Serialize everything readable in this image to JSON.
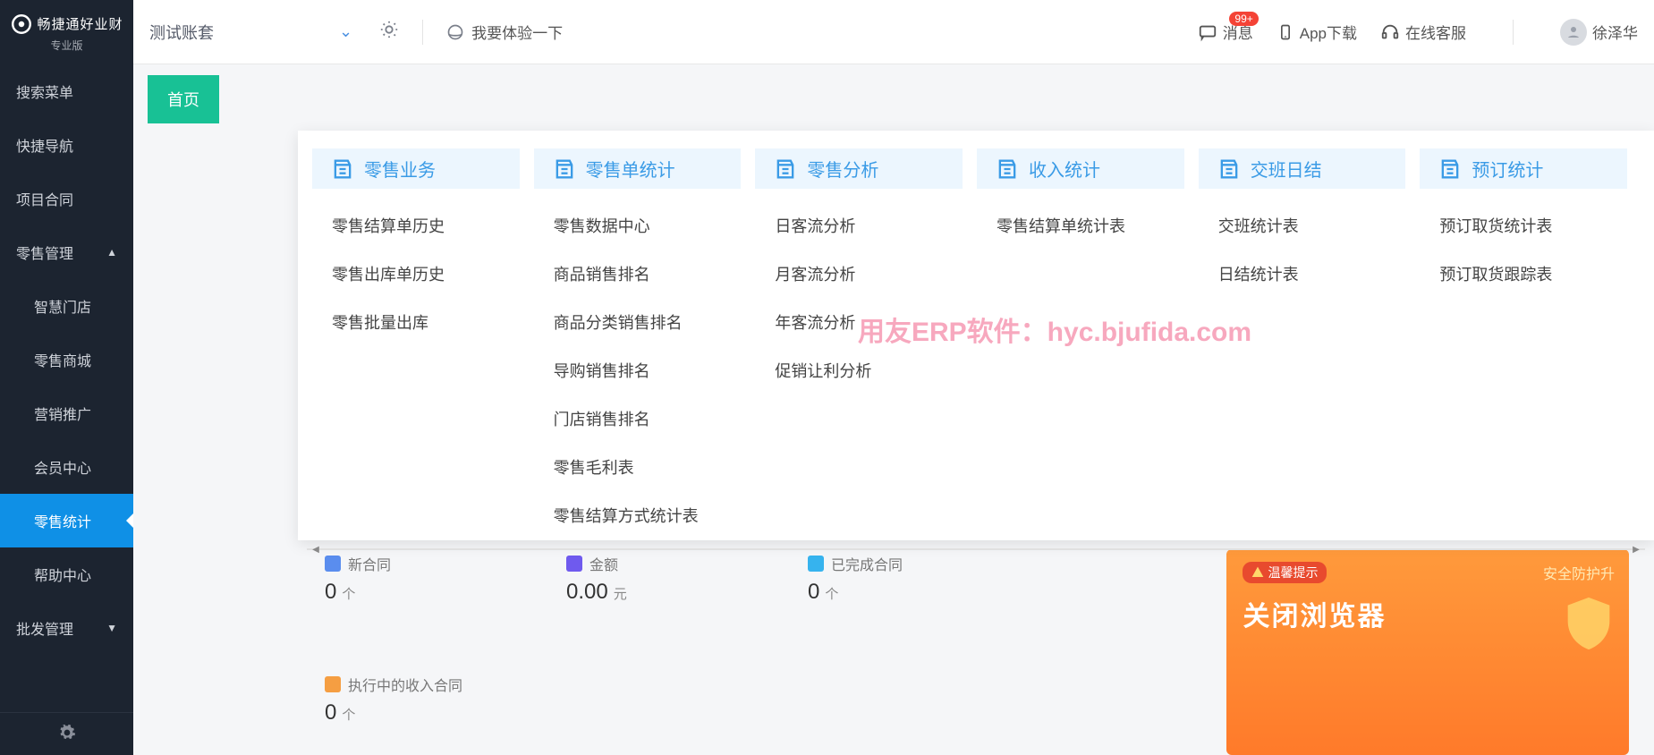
{
  "logo": {
    "title": "畅捷通好业财",
    "subtitle": "专业版"
  },
  "sidebar": {
    "items": [
      {
        "label": "搜索菜单",
        "expandable": false
      },
      {
        "label": "快捷导航",
        "expandable": false
      },
      {
        "label": "项目合同",
        "expandable": false
      },
      {
        "label": "零售管理",
        "expandable": true,
        "open": true
      },
      {
        "label": "智慧门店",
        "sub": true
      },
      {
        "label": "零售商城",
        "sub": true
      },
      {
        "label": "营销推广",
        "sub": true
      },
      {
        "label": "会员中心",
        "sub": true
      },
      {
        "label": "零售统计",
        "sub": true,
        "active": true
      },
      {
        "label": "帮助中心",
        "sub": true
      },
      {
        "label": "批发管理",
        "expandable": true
      }
    ]
  },
  "topbar": {
    "account": "测试账套",
    "experience": "我要体验一下",
    "message": "消息",
    "badge": "99+",
    "download": "App下载",
    "support": "在线客服",
    "user": "徐泽华"
  },
  "tab": {
    "home": "首页"
  },
  "mega": {
    "columns": [
      {
        "title": "零售业务",
        "icon": "doc-list",
        "items": [
          "零售结算单历史",
          "零售出库单历史",
          "零售批量出库"
        ]
      },
      {
        "title": "零售单统计",
        "icon": "report",
        "items": [
          "零售数据中心",
          "商品销售排名",
          "商品分类销售排名",
          "导购销售排名",
          "门店销售排名",
          "零售毛利表",
          "零售结算方式统计表"
        ]
      },
      {
        "title": "零售分析",
        "icon": "chart",
        "items": [
          "日客流分析",
          "月客流分析",
          "年客流分析",
          "促销让利分析"
        ]
      },
      {
        "title": "收入统计",
        "icon": "income",
        "items": [
          "零售结算单统计表"
        ]
      },
      {
        "title": "交班日结",
        "icon": "shift",
        "items": [
          "交班统计表",
          "日结统计表"
        ]
      },
      {
        "title": "预订统计",
        "icon": "booking",
        "items": [
          "预订取货统计表",
          "预订取货跟踪表"
        ]
      }
    ]
  },
  "stats": [
    {
      "label": "新合同",
      "value": "0",
      "unit": "个",
      "color": "#5a8dee"
    },
    {
      "label": "金额",
      "value": "0.00",
      "unit": "元",
      "color": "#6f5aee"
    },
    {
      "label": "已完成合同",
      "value": "0",
      "unit": "个",
      "color": "#36b3ee"
    },
    {
      "label": "执行中的收入合同",
      "value": "0",
      "unit": "个",
      "color": "#f59e42"
    }
  ],
  "banner": {
    "pill": "温馨提示",
    "right": "安全防护升",
    "big": "关闭浏览器"
  },
  "watermark": "用友ERP软件：hyc.bjufida.com"
}
